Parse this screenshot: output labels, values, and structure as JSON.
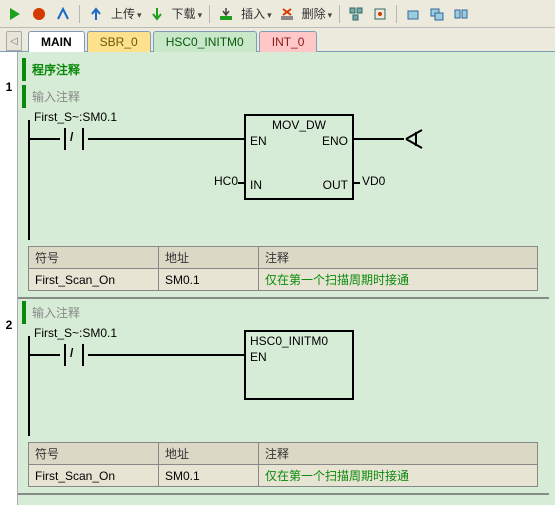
{
  "toolbar": {
    "upload": "上传",
    "download": "下载",
    "insert": "插入",
    "delete": "删除"
  },
  "tabs": {
    "main": "MAIN",
    "sbr0": "SBR_0",
    "hsc0": "HSC0_INITM0",
    "int0": "INT_0"
  },
  "prog_comment": "程序注释",
  "net1": {
    "num": "1",
    "title": "输入注释",
    "contact_label": "First_S~:SM0.1",
    "block": {
      "name": "MOV_DW",
      "en": "EN",
      "eno": "ENO",
      "in": "IN",
      "out": "OUT",
      "in_addr": "HC0",
      "out_addr": "VD0"
    },
    "table": {
      "h_sym": "符号",
      "h_addr": "地址",
      "h_cmt": "注释",
      "r_sym": "First_Scan_On",
      "r_addr": "SM0.1",
      "r_cmt": "仅在第一个扫描周期时接通"
    }
  },
  "net2": {
    "num": "2",
    "title": "输入注释",
    "contact_label": "First_S~:SM0.1",
    "block": {
      "name": "HSC0_INITM0",
      "en": "EN"
    },
    "table": {
      "h_sym": "符号",
      "h_addr": "地址",
      "h_cmt": "注释",
      "r_sym": "First_Scan_On",
      "r_addr": "SM0.1",
      "r_cmt": "仅在第一个扫描周期时接通"
    }
  }
}
